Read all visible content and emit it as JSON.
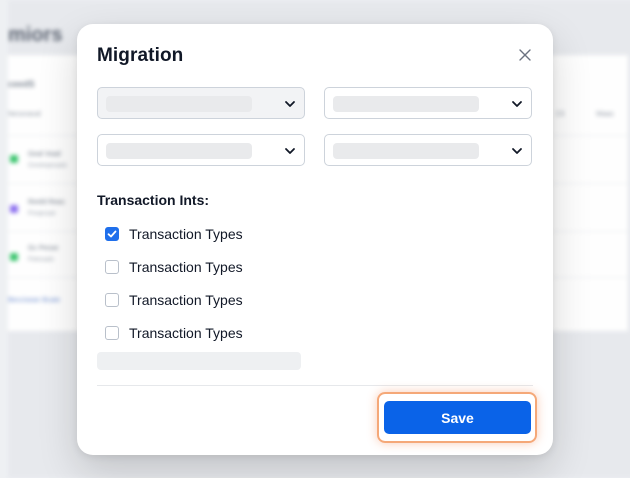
{
  "background": {
    "page_title": "miors",
    "section_label": "ceedS",
    "columns": [
      "Nessnaval",
      "Cli",
      "Waas"
    ],
    "rows": [
      {
        "title": "Geal Voad",
        "subtitle": "Greeleqesaats",
        "color": "#35c46a"
      },
      {
        "title": "Reeld Reas",
        "subtitle": "Preqesaat",
        "color": "#8a6cf0"
      },
      {
        "title": "Gc Pesse",
        "subtitle": "Pelesaals",
        "color": "#35c46a"
      }
    ],
    "link_text": "Beccisean Bcate"
  },
  "modal": {
    "title": "Migration",
    "close_icon": "close-icon",
    "selects": [
      {
        "value": "",
        "chevron_icon": "chevron-down-icon"
      },
      {
        "value": "",
        "chevron_icon": "chevron-down-icon"
      },
      {
        "value": "",
        "chevron_icon": "chevron-down-icon"
      },
      {
        "value": "",
        "chevron_icon": "chevron-down-icon"
      }
    ],
    "section_label": "Transaction Ints:",
    "options": [
      {
        "label": "Transaction Types",
        "checked": true
      },
      {
        "label": "Transaction Types",
        "checked": false
      },
      {
        "label": "Transaction Types",
        "checked": false
      },
      {
        "label": "Transaction Types",
        "checked": false
      }
    ],
    "save_label": "Save"
  },
  "colors": {
    "accent": "#0a63e8",
    "checkbox_checked": "#1f6feb",
    "focus_ring": "#f5a878"
  }
}
